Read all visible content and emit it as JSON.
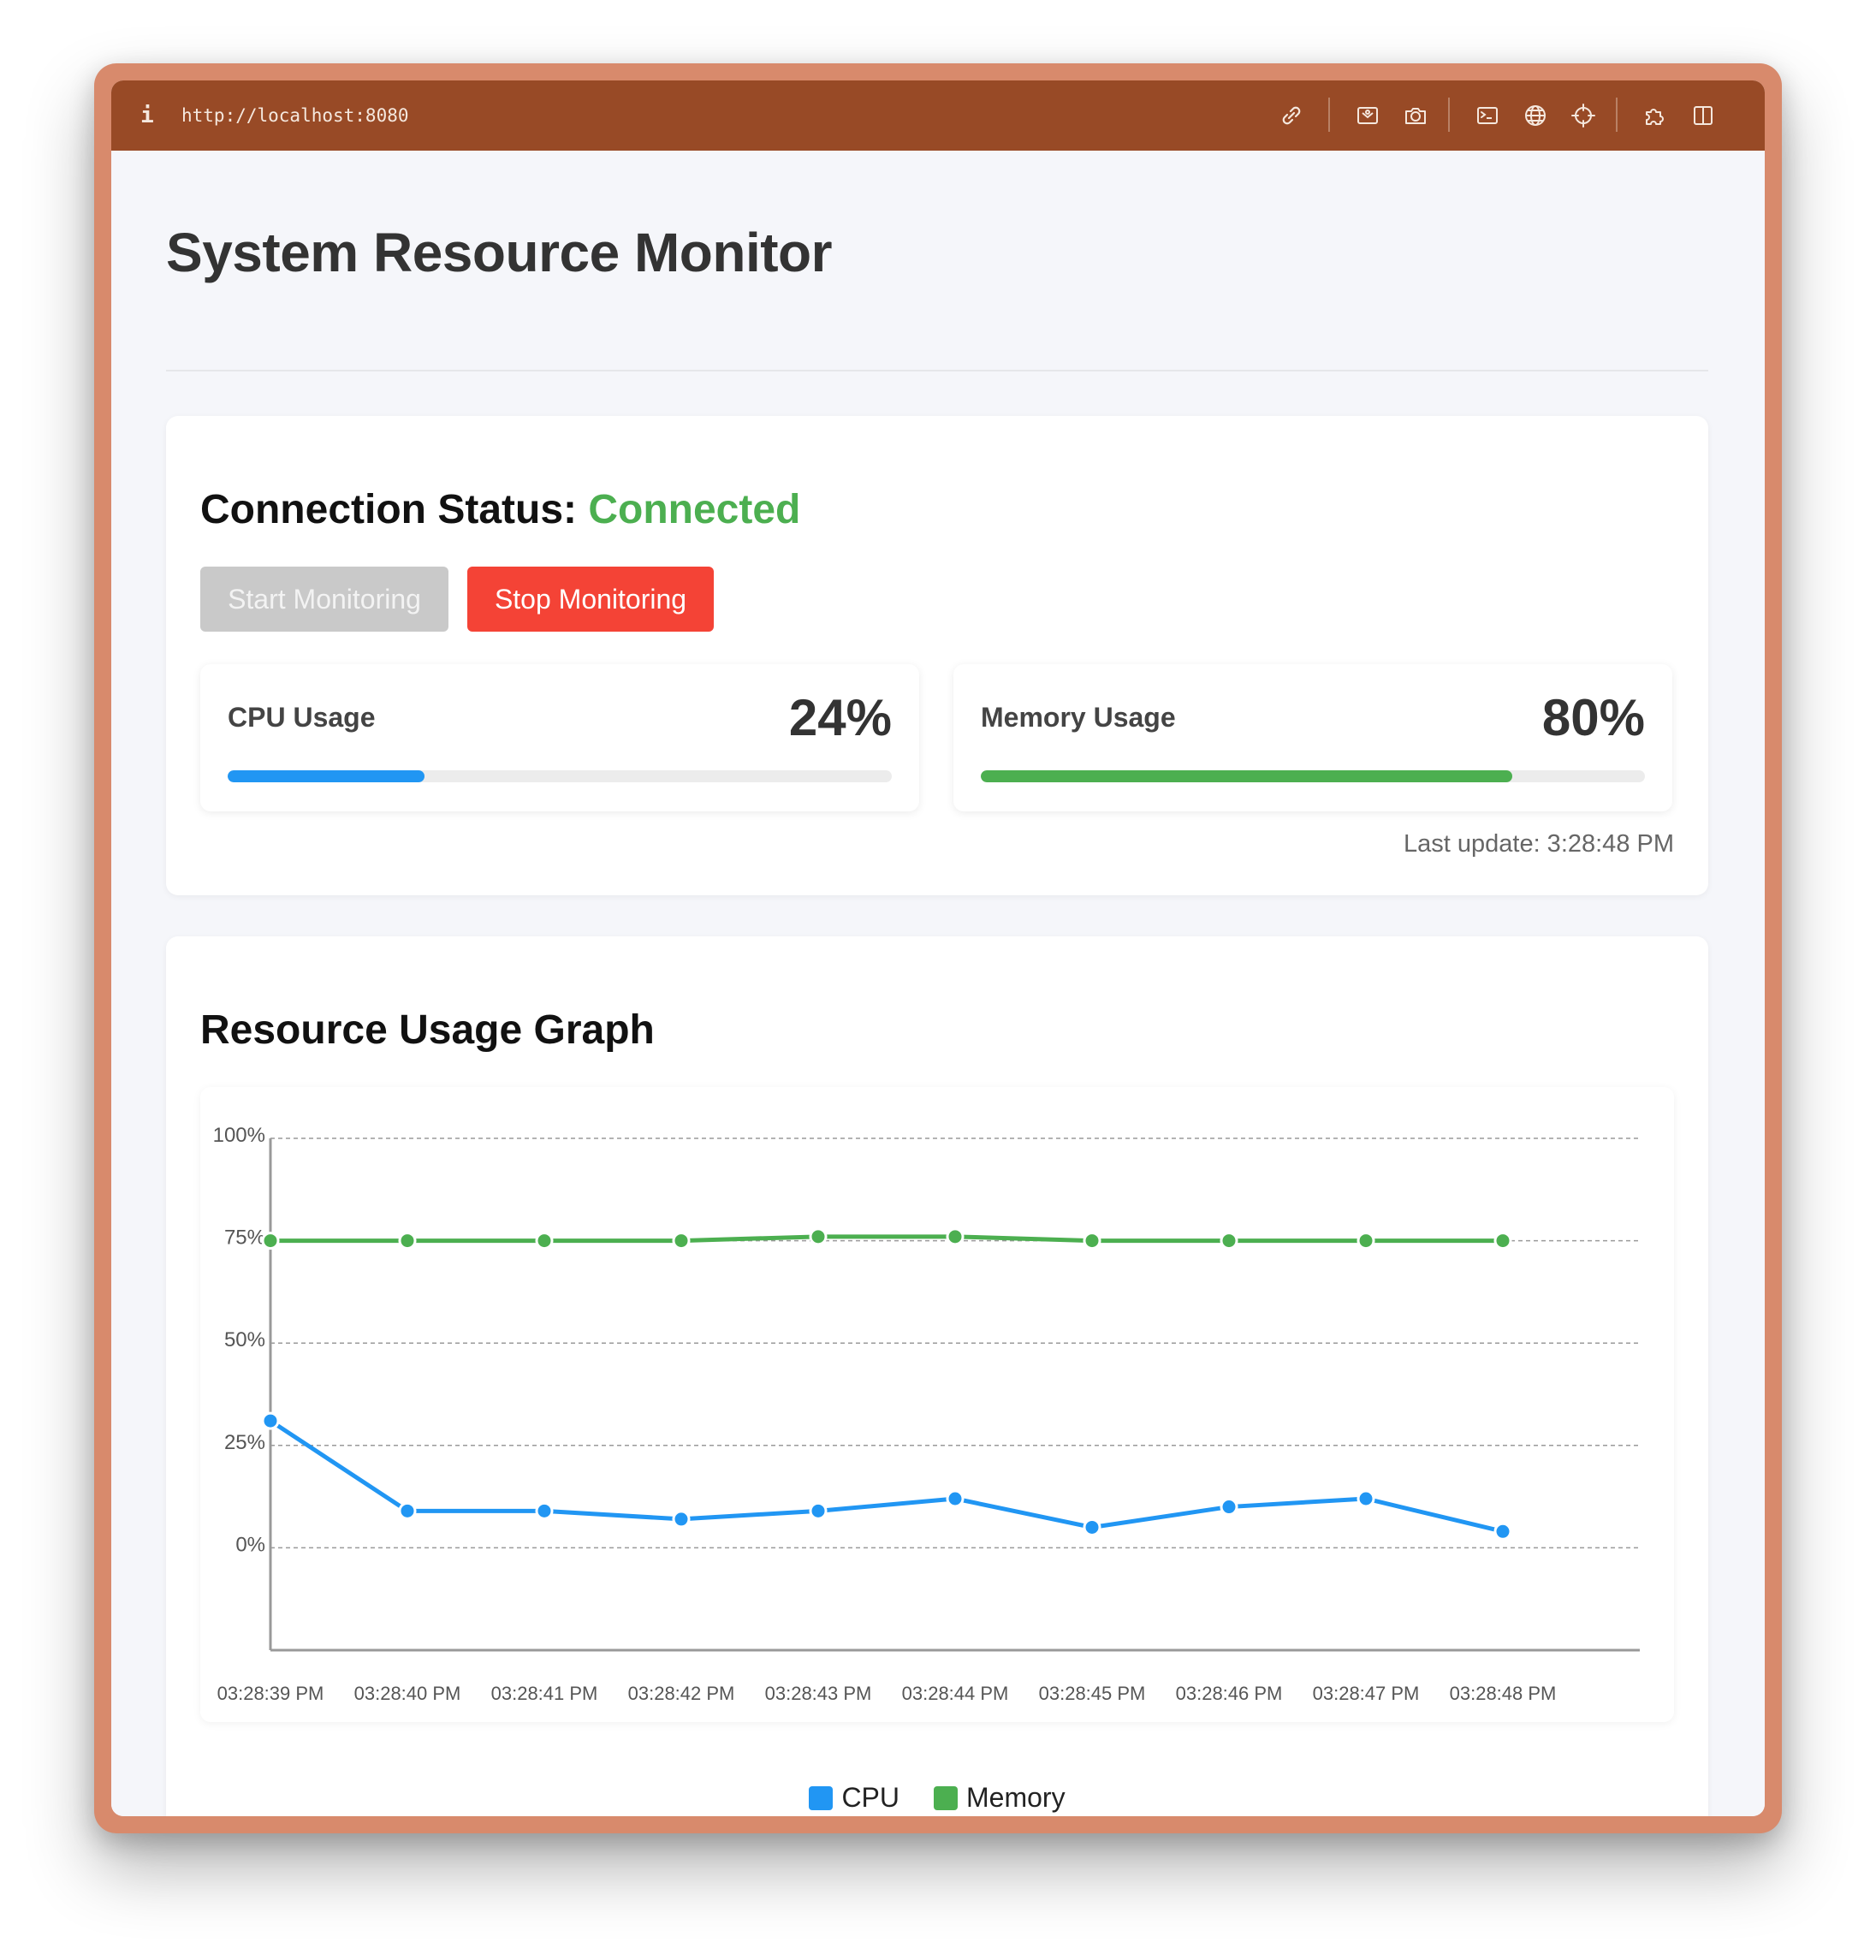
{
  "browser": {
    "url": "http://localhost:8080",
    "info_glyph": "i",
    "icons": [
      "link-icon",
      "image-icon",
      "camera-icon",
      "terminal-icon",
      "globe-icon",
      "crosshair-icon",
      "puzzle-icon",
      "sidebar-icon"
    ]
  },
  "page": {
    "title": "System Resource Monitor"
  },
  "status": {
    "heading": "Connection Status: ",
    "value": "Connected",
    "start_label": "Start Monitoring",
    "stop_label": "Stop Monitoring",
    "last_update": "Last update: 3:28:48 PM"
  },
  "metrics": {
    "cpu": {
      "label": "CPU Usage",
      "value_text": "24%",
      "fraction": 0.296,
      "color": "#2196f3"
    },
    "memory": {
      "label": "Memory Usage",
      "value_text": "80%",
      "fraction": 0.8,
      "color": "#4caf50"
    }
  },
  "graph": {
    "heading": "Resource Usage Graph"
  },
  "colors": {
    "cpu": "#2196f3",
    "memory": "#4caf50",
    "stop": "#f44336",
    "start_disabled": "#c9c9c9",
    "connected": "#4caf50"
  },
  "chart_data": {
    "type": "line",
    "title": "",
    "xlabel": "",
    "ylabel": "",
    "categories": [
      "03:28:39 PM",
      "03:28:40 PM",
      "03:28:41 PM",
      "03:28:42 PM",
      "03:28:43 PM",
      "03:28:44 PM",
      "03:28:45 PM",
      "03:28:46 PM",
      "03:28:47 PM",
      "03:28:48 PM",
      ""
    ],
    "y_ticks": [
      "100%",
      "75%",
      "50%",
      "25%",
      "0%"
    ],
    "y_tick_values": [
      100,
      75,
      50,
      25,
      0
    ],
    "ylim": [
      -25,
      100
    ],
    "grid": true,
    "legend": "bottom-center",
    "series": [
      {
        "name": "CPU",
        "color": "#2196f3",
        "values": [
          31,
          9,
          9,
          7,
          9,
          12,
          5,
          10,
          12,
          4
        ]
      },
      {
        "name": "Memory",
        "color": "#4caf50",
        "values": [
          75,
          75,
          75,
          75,
          76,
          76,
          75,
          75,
          75,
          75
        ]
      }
    ]
  }
}
